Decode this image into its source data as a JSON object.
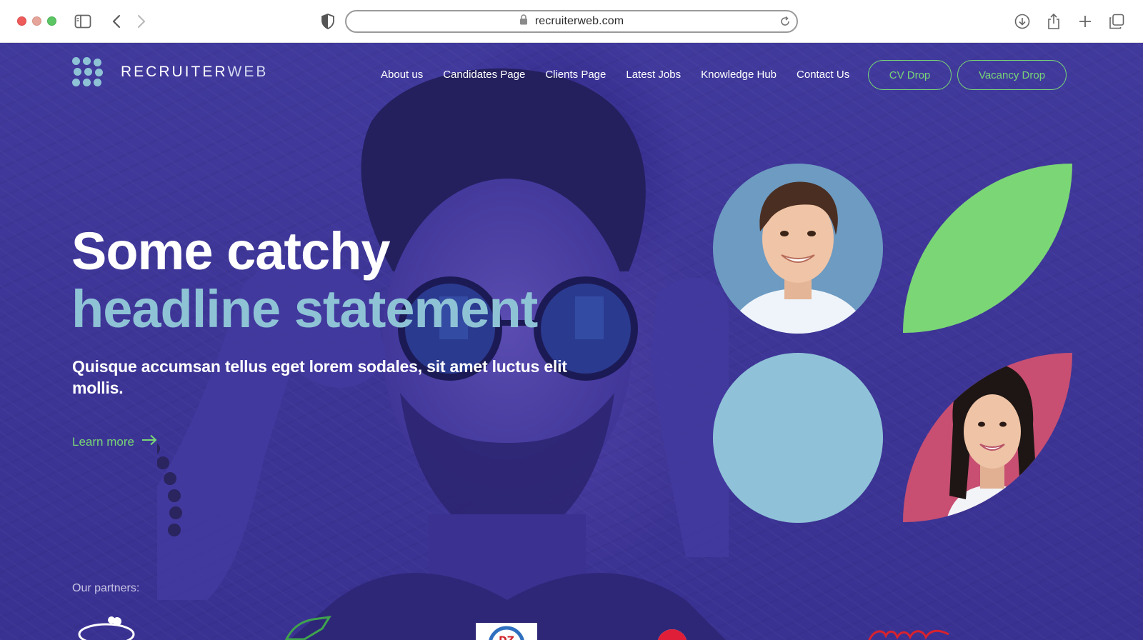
{
  "browser": {
    "url": "recruiterweb.com"
  },
  "site": {
    "logo_text_main": "RECRUITER",
    "logo_text_accent": "WEB"
  },
  "nav": {
    "items": [
      {
        "label": "About us"
      },
      {
        "label": "Candidates Page"
      },
      {
        "label": "Clients Page"
      },
      {
        "label": "Latest Jobs"
      },
      {
        "label": "Knowledge Hub"
      },
      {
        "label": "Contact Us"
      }
    ],
    "cv_drop": "CV Drop",
    "vacancy_drop": "Vacancy Drop"
  },
  "hero": {
    "headline_line1": "Some catchy",
    "headline_line2": "headline statement",
    "subtext": "Quisque accumsan tellus eget lorem sodales, sit amet luctus elit mollis.",
    "learn_more": "Learn more"
  },
  "partners": {
    "label": "Our partners:",
    "logos": [
      "fruit-brand-logo",
      "green-crest-logo",
      "dz-badge-logo",
      "pepsi-logo",
      "coca-cola-logo"
    ]
  },
  "colors": {
    "hero_bg": "#3e3697",
    "accent_green": "#78d676",
    "accent_blue": "#8ec3d6",
    "accent_pink": "#c84f72"
  }
}
